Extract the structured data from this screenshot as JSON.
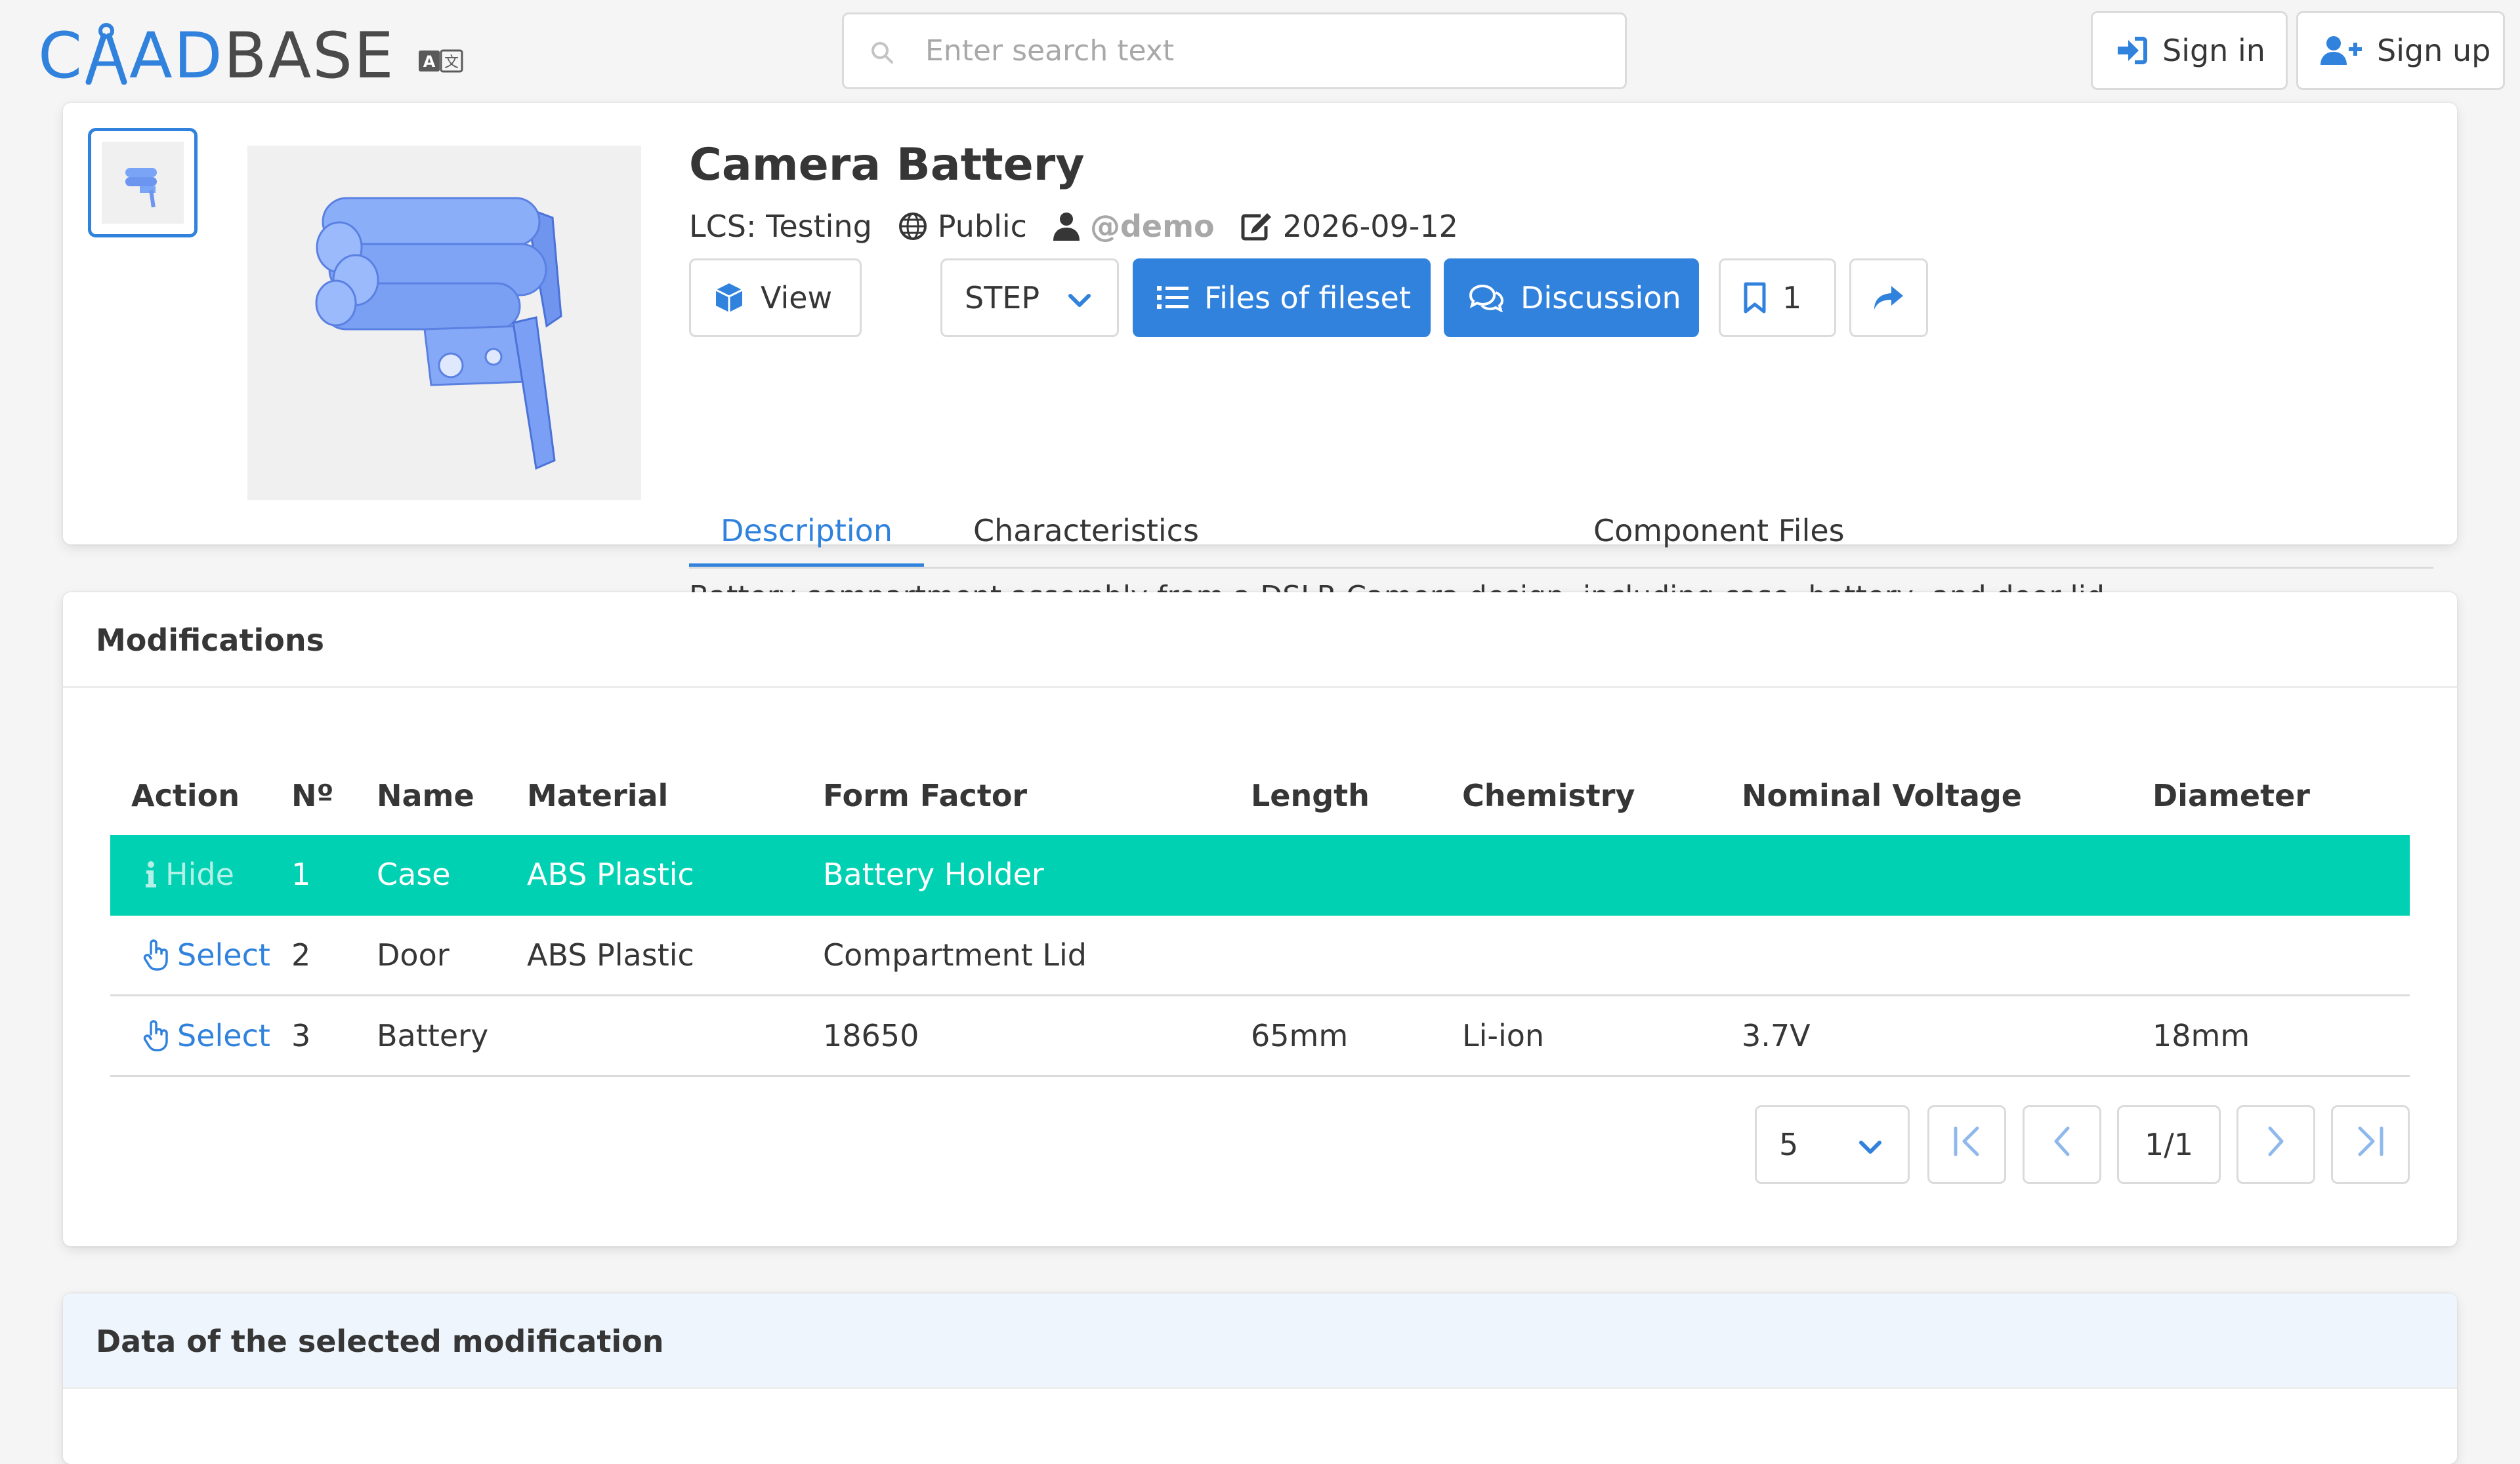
{
  "brand": {
    "logo_text_prefix": "C",
    "logo_text_accent": "AD",
    "logo_text_suffix": "BASE",
    "logo_icon": "compass-icon"
  },
  "language_icon": "translate-icon",
  "search": {
    "placeholder": "Enter search text",
    "value": ""
  },
  "auth": {
    "sign_in": "Sign in",
    "sign_up": "Sign up"
  },
  "component": {
    "title": "Camera Battery",
    "lcs": "LCS: Testing",
    "visibility": "Public",
    "owner": "@demo",
    "updated": "2026-09-12",
    "view_label": "View",
    "format_value": "STEP",
    "files_label": "Files of fileset",
    "discussion_label": "Discussion",
    "bookmarks_count": "1",
    "tabs": [
      {
        "label": "Description",
        "active": true
      },
      {
        "label": "Characteristics",
        "active": false
      },
      {
        "label": "Component Files",
        "active": false
      }
    ],
    "description": "Battery compartment assembly from a DSLR Camera design, including case, battery, and door lid."
  },
  "modifications": {
    "title": "Modifications",
    "columns": [
      "Action",
      "Nº",
      "Name",
      "Material",
      "Form Factor",
      "Length",
      "Chemistry",
      "Nominal Voltage",
      "Diameter"
    ],
    "rows": [
      {
        "action": "Hide",
        "n": "1",
        "name": "Case",
        "material": "ABS Plastic",
        "form_factor": "Battery Holder",
        "length": "",
        "chemistry": "",
        "voltage": "",
        "diameter": "",
        "selected": true
      },
      {
        "action": "Select",
        "n": "2",
        "name": "Door",
        "material": "ABS Plastic",
        "form_factor": "Compartment Lid",
        "length": "",
        "chemistry": "",
        "voltage": "",
        "diameter": "",
        "selected": false
      },
      {
        "action": "Select",
        "n": "3",
        "name": "Battery",
        "material": "",
        "form_factor": "18650",
        "length": "65mm",
        "chemistry": "Li-ion",
        "voltage": "3.7V",
        "diameter": "18mm",
        "selected": false
      }
    ],
    "page_size": "5",
    "page_indicator": "1/1"
  },
  "selected_modification": {
    "title": "Data of the selected modification"
  },
  "colors": {
    "accent": "#3082dd",
    "selected_row": "#00d1b2",
    "text": "#363636",
    "muted": "#a8a8a8"
  }
}
